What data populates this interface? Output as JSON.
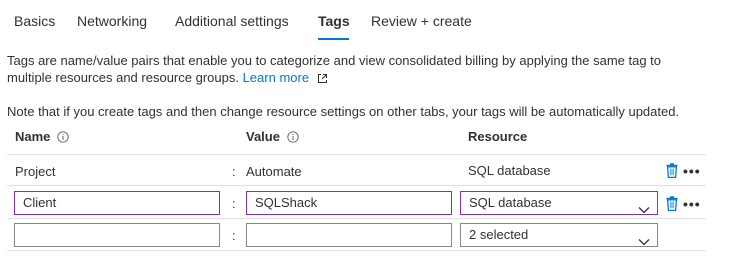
{
  "tabs": [
    {
      "label": "Basics",
      "active": false
    },
    {
      "label": "Networking",
      "active": false
    },
    {
      "label": "Additional settings",
      "active": false
    },
    {
      "label": "Tags",
      "active": true
    },
    {
      "label": "Review + create",
      "active": false
    }
  ],
  "description": {
    "text": "Tags are name/value pairs that enable you to categorize and view consolidated billing by applying the same tag to multiple resources and resource groups.",
    "learn_more": "Learn more"
  },
  "note": "Note that if you create tags and then change resource settings on other tabs, your tags will be automatically updated.",
  "columns": {
    "name": "Name",
    "value": "Value",
    "resource": "Resource"
  },
  "separator": ":",
  "rows": [
    {
      "name": "Project",
      "value": "Automate",
      "resource": "SQL database",
      "editable": false
    },
    {
      "name": "Client",
      "value": "SQLShack",
      "resource": "SQL database",
      "editable": true
    },
    {
      "name": "",
      "value": "",
      "resource": "2 selected",
      "editable": true
    }
  ],
  "colors": {
    "accent": "#0078d4",
    "focus_border": "#8b2fb0",
    "trash_icon": "#0078d4"
  }
}
